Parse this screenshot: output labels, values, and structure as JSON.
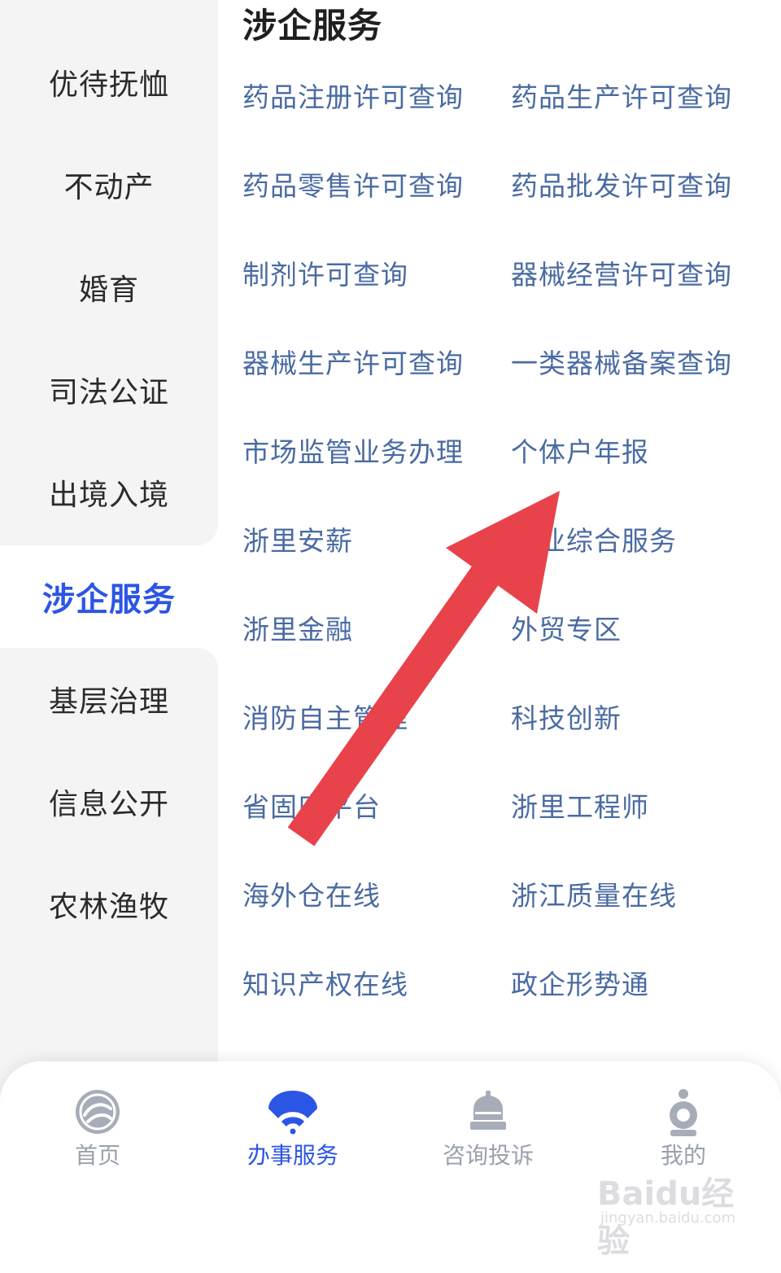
{
  "sidebar": {
    "items": [
      {
        "label": "优待抚恤"
      },
      {
        "label": "不动产"
      },
      {
        "label": "婚育"
      },
      {
        "label": "司法公证"
      },
      {
        "label": "出境入境"
      },
      {
        "label": "涉企服务"
      },
      {
        "label": "基层治理"
      },
      {
        "label": "信息公开"
      },
      {
        "label": "农林渔牧"
      }
    ],
    "active": "涉企服务"
  },
  "main": {
    "section_title": "涉企服务",
    "services": [
      {
        "label": "药品注册许可查询"
      },
      {
        "label": "药品生产许可查询"
      },
      {
        "label": "药品零售许可查询"
      },
      {
        "label": "药品批发许可查询"
      },
      {
        "label": "制剂许可查询"
      },
      {
        "label": "器械经营许可查询"
      },
      {
        "label": "器械生产许可查询"
      },
      {
        "label": "一类器械备案查询"
      },
      {
        "label": "市场监管业务办理"
      },
      {
        "label": "个体户年报"
      },
      {
        "label": "浙里安薪"
      },
      {
        "label": "企业综合服务"
      },
      {
        "label": "浙里金融"
      },
      {
        "label": "外贸专区"
      },
      {
        "label": "消防自主管理"
      },
      {
        "label": "科技创新"
      },
      {
        "label": "省固废平台"
      },
      {
        "label": "浙里工程师"
      },
      {
        "label": "海外仓在线"
      },
      {
        "label": "浙江质量在线"
      },
      {
        "label": "知识产权在线"
      },
      {
        "label": "政企形势通"
      }
    ]
  },
  "tabbar": {
    "tabs": [
      {
        "label": "首页",
        "icon": "home-logo-icon"
      },
      {
        "label": "办事服务",
        "icon": "fan-icon"
      },
      {
        "label": "咨询投诉",
        "icon": "bell-icon"
      },
      {
        "label": "我的",
        "icon": "user-icon"
      }
    ],
    "active": "办事服务"
  },
  "watermark": {
    "text": "Baidu经验",
    "subtext": "jingyan.baidu.com"
  },
  "colors": {
    "accent": "#2b55e4",
    "link": "#4a6ba2",
    "sidebar_bg": "#f4f4f5",
    "arrow": "#e8434b",
    "inactive_tab": "#9aa1ad"
  }
}
